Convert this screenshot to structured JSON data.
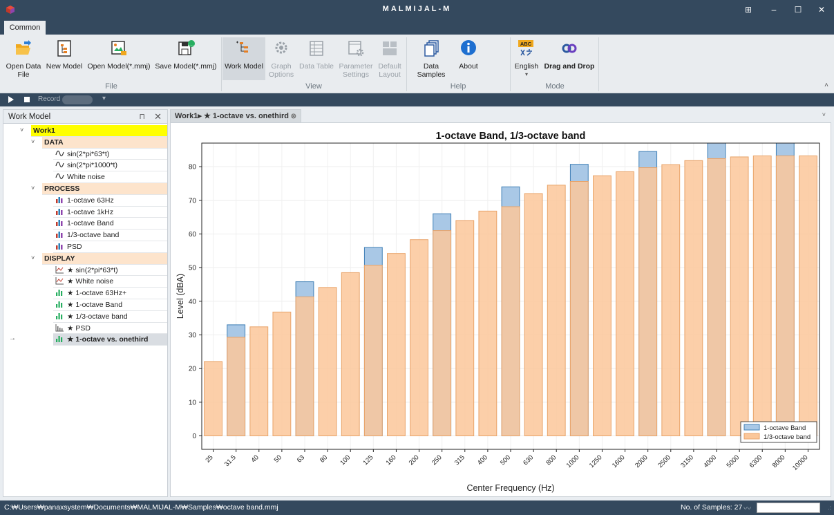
{
  "app": {
    "title": "MALMIJAL-M"
  },
  "window_buttons": [
    "⊞",
    "–",
    "☐",
    "✕"
  ],
  "ribbon": {
    "tab": "Common",
    "buttons": [
      {
        "label": "Open Data\nFile",
        "icon": "folder-open-icon"
      },
      {
        "label": "New Model",
        "icon": "new-model-icon"
      },
      {
        "label": "Open Model(*.mmj)",
        "icon": "open-model-icon"
      },
      {
        "label": "Save Model(*.mmj)",
        "icon": "save-model-icon"
      },
      {
        "label": "Work Model",
        "icon": "work-model-icon"
      },
      {
        "label": "Graph\nOptions",
        "icon": "graph-options-icon"
      },
      {
        "label": "Data Table",
        "icon": "data-table-icon"
      },
      {
        "label": "Parameter\nSettings",
        "icon": "parameter-settings-icon"
      },
      {
        "label": "Default\nLayout",
        "icon": "default-layout-icon"
      },
      {
        "label": "Data Samples",
        "icon": "data-samples-icon"
      },
      {
        "label": "About",
        "icon": "info-icon"
      },
      {
        "label": "English",
        "icon": "language-icon"
      },
      {
        "label": "Drag and Drop",
        "icon": "drag-drop-icon"
      }
    ],
    "groups": [
      "File",
      "View",
      "Help",
      "Mode"
    ],
    "language_badge": "ABC",
    "collapse": "˄"
  },
  "record": {
    "label": "Record",
    "dropdown": "▾"
  },
  "work_model": {
    "title": "Work Model",
    "pin": "⊓",
    "close": "✕",
    "root": "Work1",
    "sections": [
      {
        "name": "DATA",
        "items": [
          "sin(2*pi*63*t)",
          "sin(2*pi*1000*t)",
          "White noise"
        ]
      },
      {
        "name": "PROCESS",
        "items": [
          "1-octave 63Hz",
          "1-octave 1kHz",
          "1-octave Band",
          "1/3-octave band",
          "PSD"
        ]
      },
      {
        "name": "DISPLAY",
        "items": [
          "★ sin(2*pi*63*t)",
          "★ White noise",
          "★ 1-octave 63Hz+",
          "★ 1-octave Band",
          "★ 1/3-octave band",
          "★ PSD",
          "★ 1-octave vs. onethird"
        ]
      }
    ],
    "current_marker": "→"
  },
  "document": {
    "tab": "Work1▸ ★ 1-octave vs. onethird",
    "tab_close": "⊗",
    "menu": "˅"
  },
  "chart_data": {
    "type": "bar",
    "title": "1-octave Band, 1/3-octave band",
    "xlabel": "Center Frequency (Hz)",
    "ylabel": "Level (dBA)",
    "ylim": [
      -4,
      87
    ],
    "yticks": [
      0,
      10,
      20,
      30,
      40,
      50,
      60,
      70,
      80
    ],
    "grid": true,
    "legend_position": "bottom-right",
    "categories": [
      "25",
      "31.5",
      "40",
      "50",
      "63",
      "80",
      "100",
      "125",
      "160",
      "200",
      "250",
      "315",
      "400",
      "500",
      "630",
      "800",
      "1000",
      "1250",
      "1600",
      "2000",
      "2500",
      "3150",
      "4000",
      "5000",
      "6300",
      "8000",
      "10000"
    ],
    "series": [
      {
        "name": "1-octave Band",
        "color": "#a9c8e6",
        "edge": "#3f7fb6",
        "values": [
          null,
          33,
          null,
          null,
          45.8,
          null,
          null,
          56,
          null,
          null,
          66,
          null,
          null,
          74,
          null,
          null,
          80.7,
          null,
          null,
          84.5,
          null,
          null,
          87.6,
          null,
          null,
          87.6,
          null
        ]
      },
      {
        "name": "1/3-octave band",
        "color": "#fbc79a",
        "edge": "#e8a369",
        "values": [
          22.1,
          29.3,
          32.4,
          36.8,
          41.3,
          44.1,
          48.5,
          50.7,
          54.2,
          58.3,
          61,
          64,
          66.8,
          68.1,
          72,
          74.5,
          75.6,
          77.3,
          78.5,
          79.7,
          80.6,
          81.8,
          82.4,
          82.9,
          83.2,
          83.2,
          83.2
        ]
      }
    ]
  },
  "status": {
    "path": "C:₩Users₩panaxsystem₩Documents₩MALMIJAL-M₩Samples₩octave band.mmj",
    "samples": "No. of Samples: 27",
    "wave": "〰",
    "grip": ".:"
  }
}
